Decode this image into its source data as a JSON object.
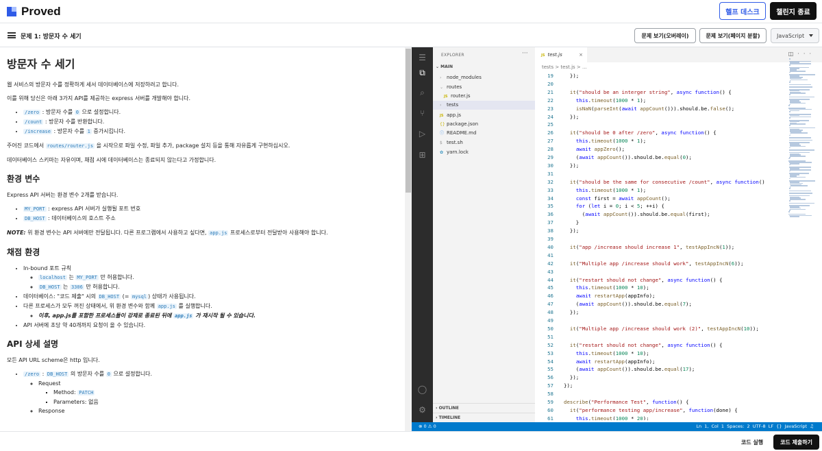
{
  "app": {
    "logo_text": "Proved",
    "help_label": "헬프 데스크",
    "end_label": "챌린지 종료"
  },
  "subbar": {
    "problem_title": "문제 1: 방문자 수 세기",
    "overlay_label": "문제 보기(오버레이)",
    "split_label": "문제 보기(페이지 분할)",
    "language": "JavaScript"
  },
  "desc": {
    "h1": "방문자 수 세기",
    "p1": "웹 서비스의 방문자 수를 정확하게 세서 데이터베이스에 저장하려고 합니다.",
    "p2": "이를 위해 당신은 아래 3가지 API를 제공하는 express 서버를 개발해야 합니다.",
    "api": [
      {
        "code": "/zero",
        "text1": " : 방문자 수를 ",
        "code2": "0",
        "text2": " 으로 설정합니다."
      },
      {
        "code": "/count",
        "text1": " : 방문자 수를 반환합니다.",
        "code2": "",
        "text2": ""
      },
      {
        "code": "/increase",
        "text1": " : 방문자 수를 ",
        "code2": "1",
        "text2": " 증가시킵니다."
      }
    ],
    "p3a": "주어진 코드에서 ",
    "p3code": "routes/router.js",
    "p3b": " 을 시작으로 파일 수정, 파일 추가, package 설치 등을 통해 자유롭게 구현하십시오.",
    "p4": "데이터베이스 스키마는 자유이며, 채점 시에 데이터베이스는 종료되지 않는다고 가정합니다.",
    "h2_env": "환경 변수",
    "env_intro": "Express API 서버는 환경 변수 2개를 받습니다.",
    "env": [
      {
        "code": "MY_PORT",
        "text": " : express API 서버가 실행될 포트 번호"
      },
      {
        "code": "DB_HOST",
        "text": " : 데이터베이스의 호스트 주소"
      }
    ],
    "note_label": "NOTE:",
    "note_a": " 위 환경 변수는 API 서버에만 전달됩니다. 다른 프로그램에서 사용하고 싶다면, ",
    "note_code": "app.js",
    "note_b": " 프로세스로부터 전달받아 사용해야 합니다.",
    "h2_grading": "채점 환경",
    "inbound": "In-bound 포트 규칙",
    "in1_code": "localhost",
    "in1_a": " 는 ",
    "in1_code2": "MY_PORT",
    "in1_b": " 만 허용합니다.",
    "in2_code": "DB_HOST",
    "in2_a": " 는 ",
    "in2_code2": "3306",
    "in2_b": " 만 허용합니다.",
    "g2_a": "데이터베이스: \"코드 제출\" 시의 ",
    "g2_code": "DB_HOST",
    "g2_b": " (= ",
    "g2_code2": "mysql",
    "g2_c": ") 상태가 사용됩니다.",
    "g3_a": "다른 프로세스가 모두 꺼진 상태에서, 위 환경 변수와 함께 ",
    "g3_code": "app.js",
    "g3_b": " 를 실행합니다.",
    "g3_sub_a": "이후, app.js를 포함한 프로세스들이 강제로 종료된 뒤에 ",
    "g3_sub_code": "app.js",
    "g3_sub_b": " 가 재시작 될 수 있습니다.",
    "g4": "API 서버에 초당 약 40개까지 요청이 올 수 있습니다.",
    "h2_api": "API 상세 설명",
    "api_intro": "모든 API URL scheme은 http 입니다.",
    "zero_code": "/zero",
    "zero_a": " : ",
    "zero_code2": "DB_HOST",
    "zero_b": " 의 방문자 수를 ",
    "zero_code3": "0",
    "zero_c": " 으로 설정합니다.",
    "request": "Request",
    "method_label": "Method: ",
    "method_code": "PATCH",
    "params": "Parameters: 없음",
    "response": "Response"
  },
  "explorer": {
    "title": "EXPLORER",
    "main": "MAIN",
    "items": [
      "node_modules",
      "routes",
      "router.js",
      "tests",
      "app.js",
      "package.json",
      "README.md",
      "test.sh",
      "yarn.lock"
    ],
    "outline": "OUTLINE",
    "timeline": "TIMELINE"
  },
  "editor": {
    "tab": "test.js",
    "breadcrumb": "tests  >  test.js  >  ...",
    "status_left": "⊗ 0  ⚠ 0",
    "status_right": "Ln 1, Col 1   Spaces: 2   UTF-8   LF   {} JavaScript   ♫"
  },
  "code_lines": [
    {
      "n": "19",
      "t": "  });"
    },
    {
      "n": "20",
      "t": ""
    },
    {
      "n": "21",
      "t": "  it(\"should be an interger string\", async function() {"
    },
    {
      "n": "22",
      "t": "    this.timeout(1000 * 1);"
    },
    {
      "n": "23",
      "t": "    isNaN(parseInt(await appCount())).should.be.false();"
    },
    {
      "n": "24",
      "t": "  });"
    },
    {
      "n": "25",
      "t": ""
    },
    {
      "n": "26",
      "t": "  it(\"should be 0 after /zero\", async function() {"
    },
    {
      "n": "27",
      "t": "    this.timeout(1000 * 1);"
    },
    {
      "n": "28",
      "t": "    await appZero();"
    },
    {
      "n": "29",
      "t": "    (await appCount()).should.be.equal(0);"
    },
    {
      "n": "30",
      "t": "  });"
    },
    {
      "n": "31",
      "t": ""
    },
    {
      "n": "32",
      "t": "  it(\"should be the same for consecutive /count\", async function()"
    },
    {
      "n": "33",
      "t": "    this.timeout(1000 * 1);"
    },
    {
      "n": "34",
      "t": "    const first = await appCount();"
    },
    {
      "n": "35",
      "t": "    for (let i = 0; i < 5; ++i) {"
    },
    {
      "n": "36",
      "t": "      (await appCount()).should.be.equal(first);"
    },
    {
      "n": "37",
      "t": "    }"
    },
    {
      "n": "38",
      "t": "  });"
    },
    {
      "n": "39",
      "t": ""
    },
    {
      "n": "40",
      "t": "  it(\"app /increase should increase 1\", testAppIncN(1));"
    },
    {
      "n": "41",
      "t": ""
    },
    {
      "n": "42",
      "t": "  it(\"Multiple app /increase should work\", testAppIncN(6));"
    },
    {
      "n": "43",
      "t": ""
    },
    {
      "n": "44",
      "t": "  it(\"restart should not change\", async function() {"
    },
    {
      "n": "45",
      "t": "    this.timeout(1000 * 10);"
    },
    {
      "n": "46",
      "t": "    await restartApp(appInfo);"
    },
    {
      "n": "47",
      "t": "    (await appCount()).should.be.equal(7);"
    },
    {
      "n": "48",
      "t": "  });"
    },
    {
      "n": "49",
      "t": ""
    },
    {
      "n": "50",
      "t": "  it(\"Multiple app /increase should work (2)\", testAppIncN(10));"
    },
    {
      "n": "51",
      "t": ""
    },
    {
      "n": "52",
      "t": "  it(\"restart should not change\", async function() {"
    },
    {
      "n": "53",
      "t": "    this.timeout(1000 * 10);"
    },
    {
      "n": "54",
      "t": "    await restartApp(appInfo);"
    },
    {
      "n": "55",
      "t": "    (await appCount()).should.be.equal(17);"
    },
    {
      "n": "56",
      "t": "  });"
    },
    {
      "n": "57",
      "t": "});"
    },
    {
      "n": "58",
      "t": ""
    },
    {
      "n": "59",
      "t": "describe(\"Performance Test\", function() {"
    },
    {
      "n": "60",
      "t": "  it(\"performance testing app/increase\", function(done) {"
    },
    {
      "n": "61",
      "t": "    this.timeout(1000 * 20);"
    }
  ],
  "bottom": {
    "run_label": "코드 실행",
    "submit_label": "코드 제출하기"
  },
  "colors": {
    "accent": "#2f5be7",
    "status_bar": "#007acc",
    "code_bg": "#e9f3fb"
  }
}
